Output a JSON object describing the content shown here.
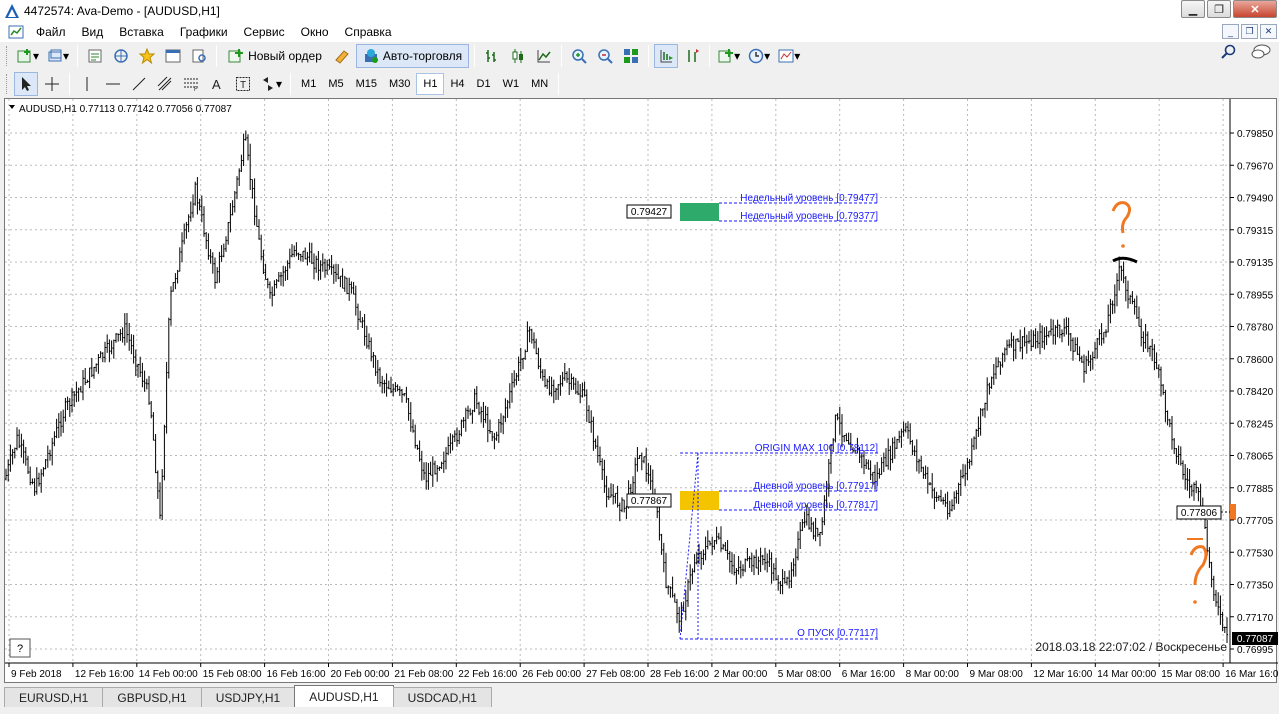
{
  "window": {
    "title": "4472574: Ava-Demo - [AUDUSD,H1]"
  },
  "menu": [
    "Файл",
    "Вид",
    "Вставка",
    "Графики",
    "Сервис",
    "Окно",
    "Справка"
  ],
  "toolbar": {
    "new_order_label": "Новый ордер",
    "auto_trading_label": "Авто-торговля"
  },
  "timeframes": [
    "M1",
    "M5",
    "M15",
    "M30",
    "H1",
    "H4",
    "D1",
    "W1",
    "MN"
  ],
  "active_timeframe": "H1",
  "chart": {
    "header": "AUDUSD,H1  0.77113 0.77142 0.77056 0.77087",
    "price_axis": [
      "0.79850",
      "0.79670",
      "0.79490",
      "0.79315",
      "0.79135",
      "0.78955",
      "0.78780",
      "0.78600",
      "0.78420",
      "0.78245",
      "0.78065",
      "0.77885",
      "0.77705",
      "0.77530",
      "0.77350",
      "0.77170",
      "0.76995"
    ],
    "current_price": "0.77087",
    "time_axis": [
      "9 Feb 2018",
      "12 Feb 16:00",
      "14 Feb 00:00",
      "15 Feb 08:00",
      "16 Feb 16:00",
      "20 Feb 00:00",
      "21 Feb 08:00",
      "22 Feb 16:00",
      "26 Feb 00:00",
      "27 Feb 08:00",
      "28 Feb 16:00",
      "2 Mar 00:00",
      "5 Mar 08:00",
      "6 Mar 16:00",
      "8 Mar 00:00",
      "9 Mar 08:00",
      "12 Mar 16:00",
      "14 Mar 00:00",
      "15 Mar 08:00",
      "16 Mar 16:00"
    ],
    "levels": {
      "weekly_1": "Недельный уровень [0.79477]",
      "weekly_2": "Недельный уровень [0.79377]",
      "weekly_box_price": "0.79427",
      "origin_max": "ORIGIN MAX 100 [0.78112]",
      "daily_1": "Дневной уровень [0.77917]",
      "daily_2": "Дневной уровень [0.77817]",
      "daily_box_price": "0.77867",
      "start": "О     ПУСК [0.77117]",
      "right_box_price": "0.77806"
    },
    "server_time": "2018.03.18 22:07:02 / Воскресенье",
    "help_button": "?",
    "colors": {
      "weekly_box": "#2eaa6a",
      "daily_box": "#f5c400",
      "level_text": "#1a1aff",
      "annotation": "#f07820"
    }
  },
  "tabs": [
    "EURUSD,H1",
    "GBPUSD,H1",
    "USDJPY,H1",
    "AUDUSD,H1",
    "USDCAD,H1"
  ],
  "active_tab": "AUDUSD,H1"
}
